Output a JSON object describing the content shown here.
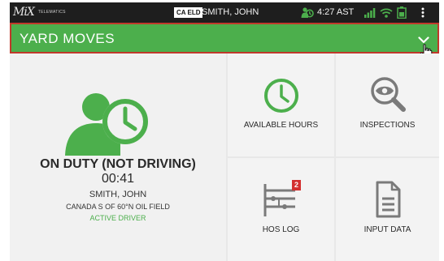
{
  "status_bar": {
    "logo_text": "MiX",
    "logo_subtext": "TELEMATICS",
    "eld_badge": "CA ELD",
    "driver_name": "SMITH, JOHN",
    "time": "4:27 AST",
    "icons": [
      "driver-clock-icon",
      "signal-icon",
      "wifi-icon",
      "battery-icon",
      "overflow-menu-icon"
    ]
  },
  "header": {
    "title": "YARD MOVES",
    "icon": "chevron-down-icon"
  },
  "status_panel": {
    "status": "ON DUTY (NOT DRIVING)",
    "timer": "00:41",
    "driver": "SMITH, JOHN",
    "location": "CANADA S OF 60°N OIL FIELD",
    "role": "ACTIVE DRIVER",
    "icon": "driver-clock-icon"
  },
  "tiles": [
    {
      "label": "AVAILABLE HOURS",
      "icon": "clock-icon"
    },
    {
      "label": "INSPECTIONS",
      "icon": "magnifier-eye-icon"
    },
    {
      "label": "HOS LOG",
      "icon": "hos-log-icon",
      "badge": "2"
    },
    {
      "label": "INPUT DATA",
      "icon": "document-icon"
    }
  ],
  "colors": {
    "accent_green": "#4caf4c",
    "header_border": "#c0392b",
    "badge_red": "#d32f2f",
    "status_bar": "#1e1e1e"
  }
}
